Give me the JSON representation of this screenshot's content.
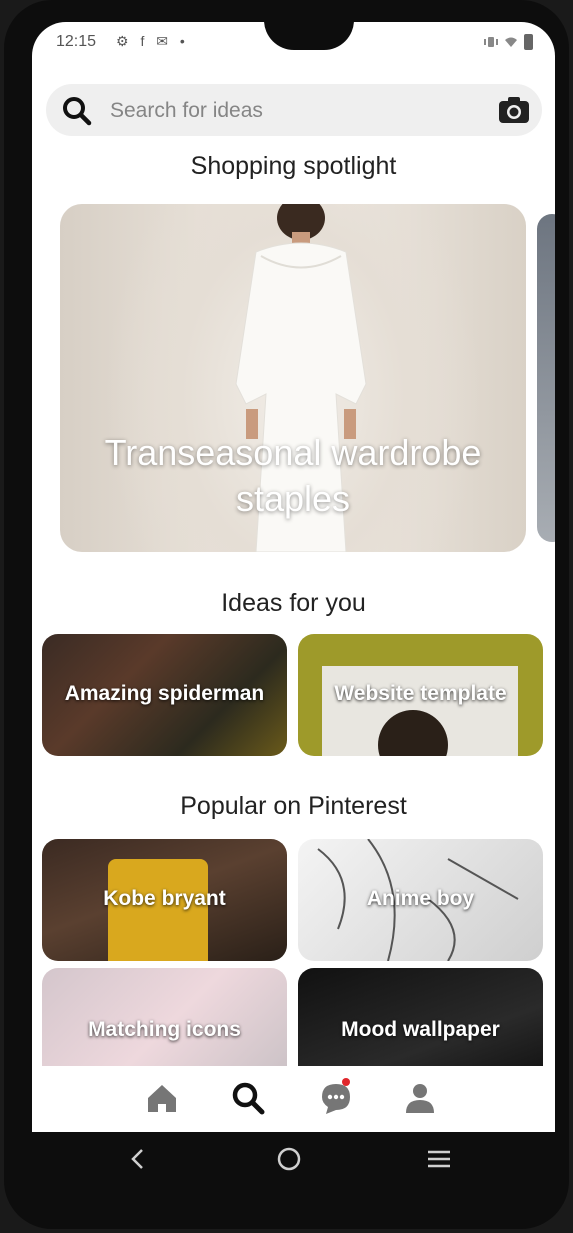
{
  "status_bar": {
    "time": "12:15",
    "left_icons": "⚙ f ✉ •"
  },
  "search": {
    "placeholder": "Search for ideas"
  },
  "spotlight": {
    "section_title": "Shopping spotlight",
    "title": "Transeasonal wardrobe staples"
  },
  "ideas": {
    "section_title": "Ideas for you",
    "items": [
      {
        "label": "Amazing spiderman"
      },
      {
        "label": "Website template"
      }
    ]
  },
  "popular": {
    "section_title": "Popular on Pinterest",
    "items": [
      {
        "label": "Kobe bryant"
      },
      {
        "label": "Anime boy"
      },
      {
        "label": "Matching icons"
      },
      {
        "label": "Mood wallpaper"
      }
    ]
  },
  "bottom_nav": {
    "items": [
      {
        "icon": "home-icon"
      },
      {
        "icon": "search-icon",
        "active": true
      },
      {
        "icon": "chat-icon",
        "badge": true
      },
      {
        "icon": "profile-icon"
      }
    ]
  },
  "colors": {
    "badge": "#e0262b",
    "icon_inactive": "#767676",
    "icon_active": "#111111"
  }
}
